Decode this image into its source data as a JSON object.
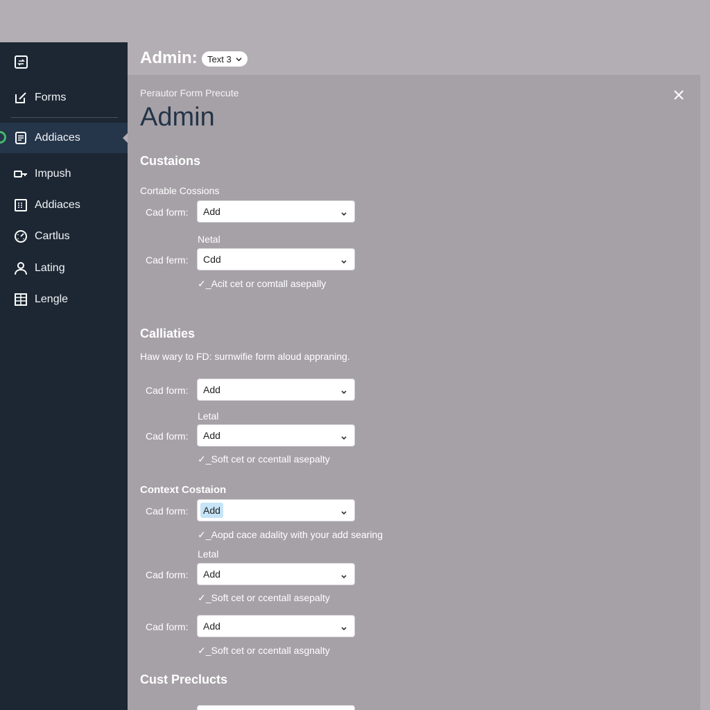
{
  "sidebar": {
    "items": [
      {
        "label": "Forms"
      },
      {
        "label": "Addiaces"
      },
      {
        "label": "Impush"
      },
      {
        "label": "Addiaces"
      },
      {
        "label": "Cartlus"
      },
      {
        "label": "Lating"
      },
      {
        "label": "Lengle"
      }
    ]
  },
  "header": {
    "title": "Admin:",
    "pill": "Text 3"
  },
  "panel": {
    "subtitle": "Perautor Form Precute",
    "title": "Admin"
  },
  "sections": {
    "s1": {
      "title": "Custaions",
      "note": "Cortable Cossions",
      "row1": {
        "label": "Cad form:",
        "value": "Add"
      },
      "sublabel": "Netal",
      "row2": {
        "label": "Cad ferm:",
        "value": "Cdd"
      },
      "check": "✓_Acit cet or comtall asepally"
    },
    "s2": {
      "title": "Calliaties",
      "note": "Haw wary to FD: surnwifie form aloud appraning.",
      "row1": {
        "label": "Cad form:",
        "value": "Add"
      },
      "sublabel": "Letal",
      "row2": {
        "label": "Cad form:",
        "value": "Add"
      },
      "check": "✓_Soft cet or ccentall asepalty"
    },
    "s3": {
      "title": "Context Costaion",
      "row1": {
        "label": "Cad form:",
        "value": "Add"
      },
      "check1": "✓_Aopd cace adality with your add searing",
      "sublabel": "Letal",
      "row2": {
        "label": "Cad form:",
        "value": "Add"
      },
      "check2": "✓_Soft cet or ccentall asepalty",
      "row3": {
        "label": "Cad form:",
        "value": "Add"
      },
      "check3": "✓_Soft cet or ccentall asgnalty"
    },
    "s4": {
      "title": "Cust Preclucts"
    }
  }
}
